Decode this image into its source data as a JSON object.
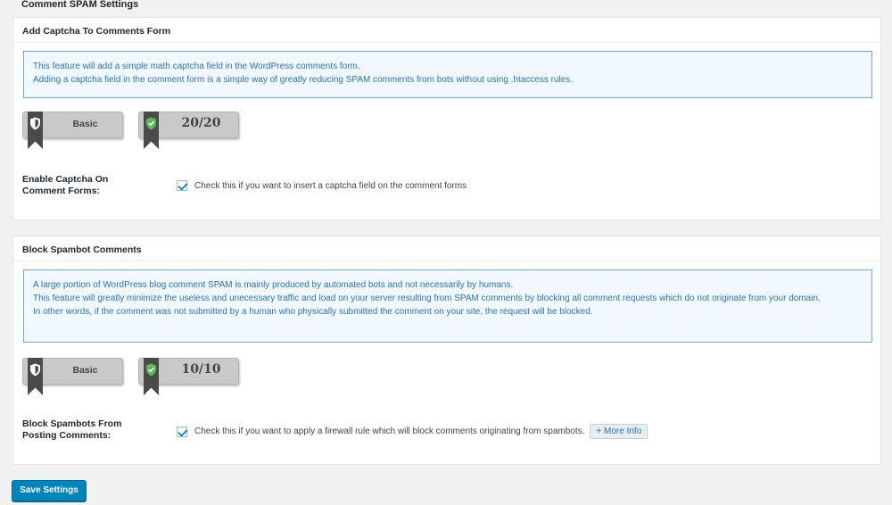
{
  "page": {
    "title": "Comment SPAM Settings"
  },
  "captcha": {
    "header": "Add Captcha To Comments Form",
    "info_line1": "This feature will add a simple math captcha field in the WordPress comments form.",
    "info_line2": "Adding a captcha field in the comment form is a simple way of greatly reducing SPAM comments from bots without using .htaccess rules.",
    "level": "Basic",
    "score": "20/20",
    "label": "Enable Captcha On Comment Forms:",
    "checked": true,
    "description": "Check this if you want to insert a captcha field on the comment forms"
  },
  "spambot": {
    "header": "Block Spambot Comments",
    "info_line1": "A large portion of WordPress blog comment SPAM is mainly produced by automated bots and not necessarily by humans.",
    "info_line2": "This feature will greatly minimize the useless and unecessary traffic and load on your server resulting from SPAM comments by blocking all comment requests which do not originate from your domain.",
    "info_line3": "In other words, if the comment was not submitted by a human who physically submitted the comment on your site, the request will be blocked.",
    "level": "Basic",
    "score": "10/10",
    "label": "Block Spambots From Posting Comments:",
    "checked": true,
    "description": "Check this if you want to apply a firewall rule which will block comments originating from spambots.",
    "more_info": "+ More Info"
  },
  "actions": {
    "save_label": "Save Settings"
  },
  "colors": {
    "accent": "#0085ba",
    "info_text": "#2873b5",
    "info_bg": "#f1f8ff"
  }
}
